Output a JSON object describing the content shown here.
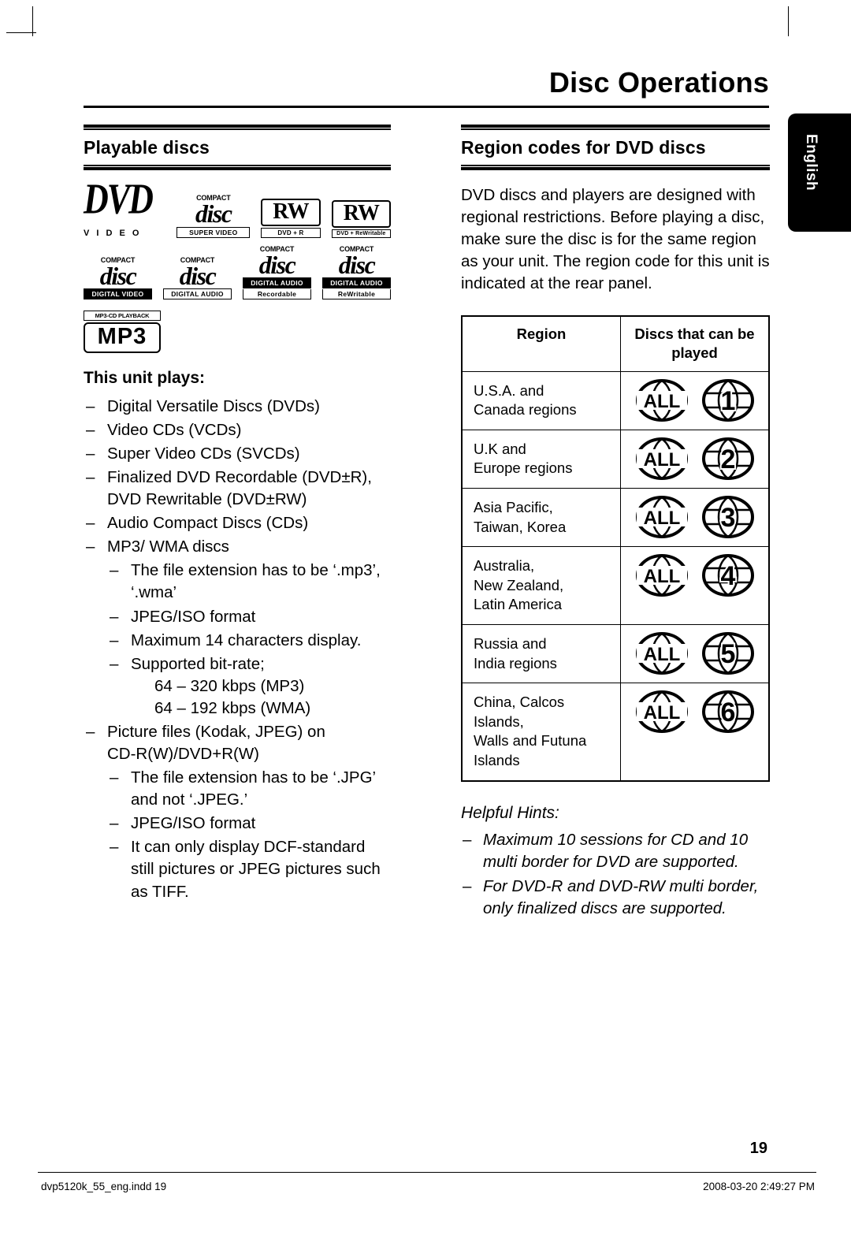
{
  "page": {
    "title": "Disc Operations",
    "language_tab": "English",
    "page_number": "19",
    "footer_left": "dvp5120k_55_eng.indd   19",
    "footer_right": "2008-03-20   2:49:27 PM"
  },
  "left_column": {
    "heading": "Playable discs",
    "logos": [
      {
        "name": "dvd-video-logo",
        "word": "DVD",
        "sub": "V I D E O"
      },
      {
        "name": "compact-disc-super-video-logo",
        "top": "COMPACT",
        "word": "disc",
        "bottom": "SUPER  VIDEO"
      },
      {
        "name": "dvd-plus-r-logo",
        "word": "RW",
        "sub": "DVD + R"
      },
      {
        "name": "dvd-plus-rewritable-logo",
        "word": "RW",
        "sub": "DVD + ReWritable"
      },
      {
        "name": "compact-disc-digital-video-logo",
        "top": "COMPACT",
        "word": "disc",
        "bottom": "DIGITAL VIDEO"
      },
      {
        "name": "compact-disc-digital-audio-logo",
        "top": "COMPACT",
        "word": "disc",
        "bottom": "DIGITAL AUDIO"
      },
      {
        "name": "compact-disc-digital-audio-recordable-logo",
        "top": "COMPACT",
        "word": "disc",
        "bottom": "DIGITAL AUDIO",
        "bottom2": "Recordable"
      },
      {
        "name": "compact-disc-digital-audio-rewritable-logo",
        "top": "COMPACT",
        "word": "disc",
        "bottom": "DIGITAL AUDIO",
        "bottom2": "ReWritable"
      },
      {
        "name": "mp3-cd-playback-logo",
        "top": "MP3-CD PLAYBACK",
        "word": "MP3"
      }
    ],
    "unit_plays_heading": "This unit plays:",
    "items": [
      {
        "text": "Digital Versatile Discs (DVDs)"
      },
      {
        "text": "Video CDs (VCDs)"
      },
      {
        "text": "Super Video CDs (SVCDs)"
      },
      {
        "text": "Finalized DVD Recordable (DVD±R),",
        "cont": "DVD Rewritable (DVD±RW)"
      },
      {
        "text": "Audio Compact Discs (CDs)"
      },
      {
        "text": "MP3/ WMA discs",
        "sub": [
          {
            "text": "The file extension has to be ‘.mp3’,",
            "cont": "‘.wma’"
          },
          {
            "text": "JPEG/ISO format"
          },
          {
            "text": "Maximum 14 characters display."
          },
          {
            "text": "Supported bit-rate;",
            "cont": "64 – 320 kbps (MP3)",
            "cont2": "64 – 192 kbps (WMA)"
          }
        ]
      },
      {
        "text": "Picture files (Kodak, JPEG) on",
        "cont": "CD-R(W)/DVD+R(W)",
        "sub": [
          {
            "text": "The file extension has to be ‘.JPG’",
            "cont": "and not ‘.JPEG.’"
          },
          {
            "text": "JPEG/ISO format"
          },
          {
            "text": "It can only display DCF-standard",
            "cont": "still pictures or JPEG pictures such",
            "cont2": "as TIFF."
          }
        ]
      }
    ]
  },
  "right_column": {
    "heading": "Region codes for DVD discs",
    "intro": "DVD discs and players are designed with regional restrictions. Before playing a disc, make sure the disc is for the same region as your unit. The region code for this unit is indicated at the rear panel.",
    "table": {
      "headers": [
        "Region",
        "Discs that can be played"
      ],
      "rows": [
        {
          "region": [
            "U.S.A. and",
            "Canada regions"
          ],
          "icons": [
            "ALL",
            "1"
          ]
        },
        {
          "region": [
            "U.K and",
            "Europe regions"
          ],
          "icons": [
            "ALL",
            "2"
          ]
        },
        {
          "region": [
            "Asia Pacific,",
            "Taiwan, Korea"
          ],
          "icons": [
            "ALL",
            "3"
          ]
        },
        {
          "region": [
            "Australia,",
            "New Zealand,",
            "Latin America"
          ],
          "icons": [
            "ALL",
            "4"
          ]
        },
        {
          "region": [
            "Russia and",
            "India regions"
          ],
          "icons": [
            "ALL",
            "5"
          ]
        },
        {
          "region": [
            "China, Calcos",
            "Islands,",
            "Walls and Futuna",
            "Islands"
          ],
          "icons": [
            "ALL",
            "6"
          ]
        }
      ]
    },
    "hints": {
      "title": "Helpful Hints:",
      "items": [
        "Maximum 10 sessions for CD and 10 multi border for DVD are supported.",
        "For DVD-R and DVD-RW multi border, only finalized discs are supported."
      ]
    }
  }
}
